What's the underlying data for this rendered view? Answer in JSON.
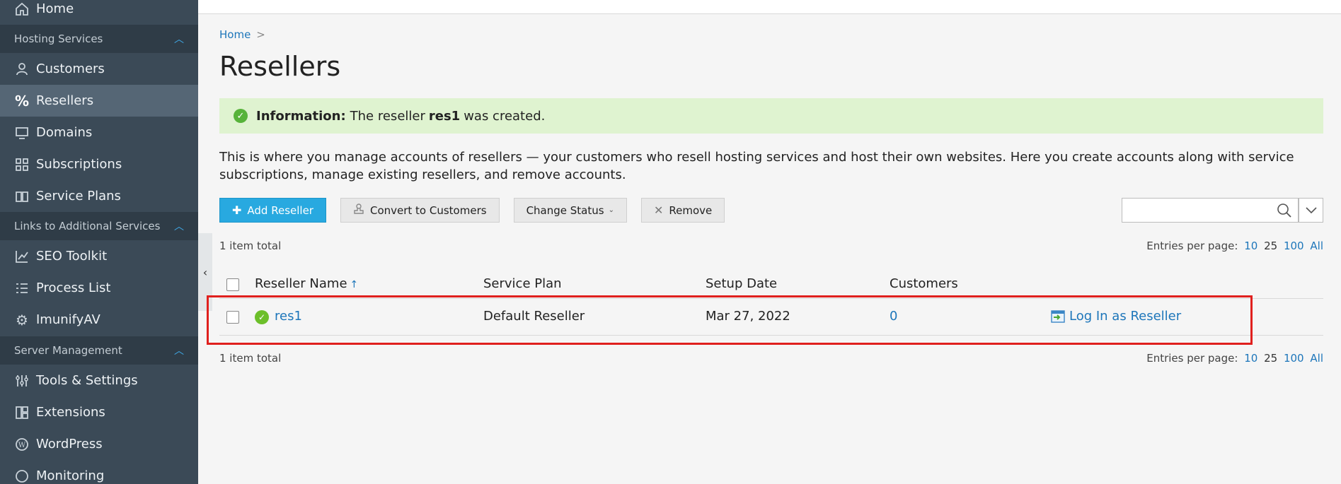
{
  "sidebar": {
    "home": "Home",
    "sections": [
      {
        "label": "Hosting Services"
      },
      {
        "label": "Links to Additional Services"
      },
      {
        "label": "Server Management"
      }
    ],
    "items": [
      {
        "label": "Customers",
        "icon": "user-icon"
      },
      {
        "label": "Resellers",
        "icon": "percent-icon",
        "active": true
      },
      {
        "label": "Domains",
        "icon": "monitor-icon"
      },
      {
        "label": "Subscriptions",
        "icon": "grid-icon"
      },
      {
        "label": "Service Plans",
        "icon": "book-icon"
      },
      {
        "label": "SEO Toolkit",
        "icon": "chart-icon"
      },
      {
        "label": "Process List",
        "icon": "list-icon"
      },
      {
        "label": "ImunifyAV",
        "icon": "gear-icon"
      },
      {
        "label": "Tools & Settings",
        "icon": "sliders-icon"
      },
      {
        "label": "Extensions",
        "icon": "extensions-icon"
      },
      {
        "label": "WordPress",
        "icon": "wordpress-icon"
      },
      {
        "label": "Monitoring",
        "icon": "monitoring-icon"
      }
    ]
  },
  "breadcrumb": {
    "home": "Home",
    "separator": ">"
  },
  "page": {
    "title": "Resellers"
  },
  "info": {
    "label": "Information:",
    "text_before": "The reseller",
    "reseller": "res1",
    "text_after": "was created."
  },
  "description": "This is where you manage accounts of resellers — your customers who resell hosting services and host their own websites. Here you create accounts along with service subscriptions, manage existing resellers, and remove accounts.",
  "toolbar": {
    "add": "Add Reseller",
    "convert": "Convert to Customers",
    "change_status": "Change Status",
    "remove": "Remove"
  },
  "search": {
    "placeholder": "",
    "value": ""
  },
  "list": {
    "total_top": "1 item total",
    "total_bottom": "1 item total",
    "entries_label": "Entries per page:",
    "entries_options": [
      "10",
      "25",
      "100",
      "All"
    ]
  },
  "table": {
    "columns": [
      "Reseller Name",
      "Service Plan",
      "Setup Date",
      "Customers"
    ],
    "sort_arrow": "↑",
    "rows": [
      {
        "name": "res1",
        "plan": "Default Reseller",
        "date": "Mar 27, 2022",
        "customers": "0",
        "action": "Log In as Reseller"
      }
    ]
  },
  "colors": {
    "accent": "#28a9e0",
    "link": "#1d76ba",
    "sidebar": "#3b4a57",
    "success": "#dff3d0",
    "highlight": "#e0201e"
  }
}
